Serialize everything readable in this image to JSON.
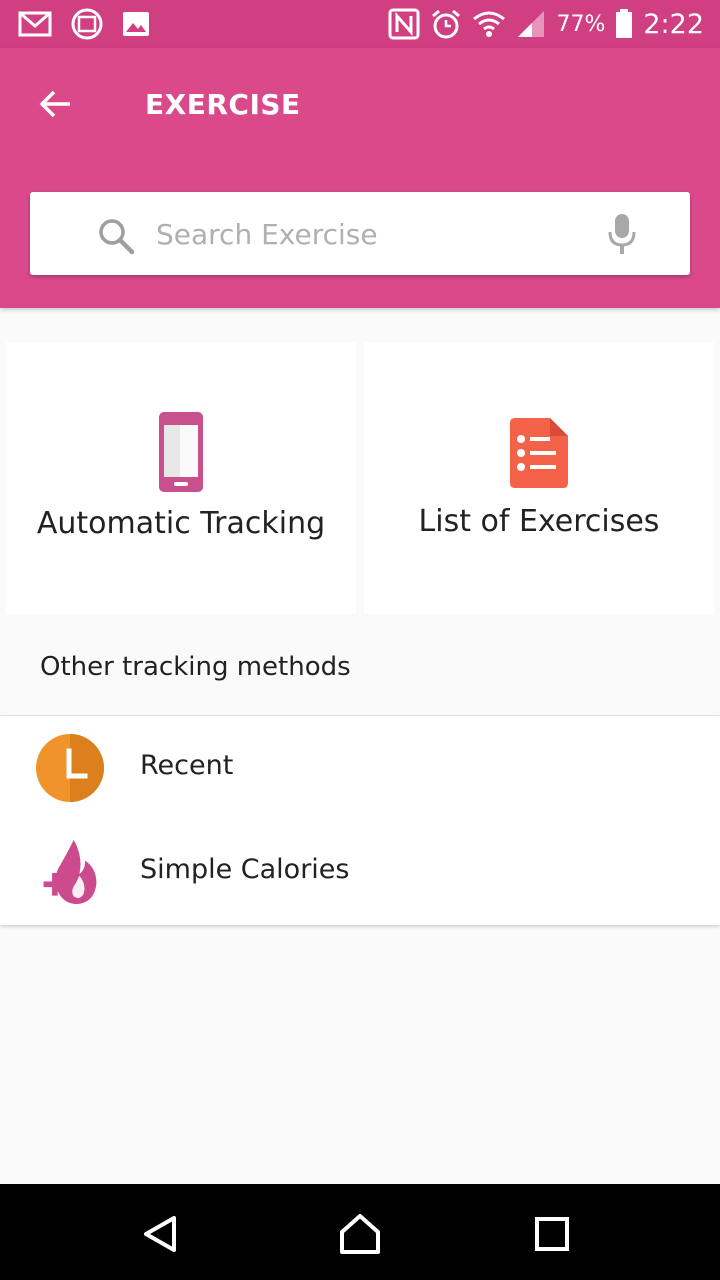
{
  "status_bar": {
    "battery": "77%",
    "time": "2:22"
  },
  "header": {
    "title": "EXERCISE"
  },
  "search": {
    "placeholder": "Search Exercise",
    "value": ""
  },
  "cards": [
    {
      "label": "Automatic Tracking",
      "icon": "phone-icon"
    },
    {
      "label": "List of Exercises",
      "icon": "document-list-icon"
    }
  ],
  "section": {
    "title": "Other tracking methods"
  },
  "list": {
    "items": [
      {
        "label": "Recent",
        "icon": "clock-icon"
      },
      {
        "label": "Simple Calories",
        "icon": "flame-plus-icon"
      }
    ]
  },
  "colors": {
    "status_bar": "#d03f82",
    "app_bar": "#da4a8b",
    "accent_orange": "#f0932a",
    "accent_red": "#f4624a",
    "accent_pink": "#cc4a8e"
  }
}
